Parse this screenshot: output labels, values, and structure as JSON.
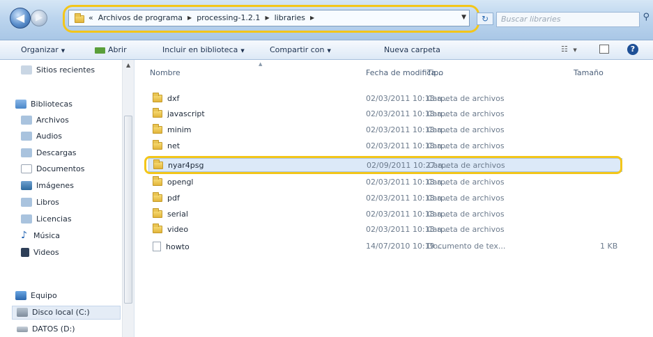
{
  "address": {
    "back_glyph": "◀",
    "forward_glyph": "▶",
    "overflow": "«",
    "crumbs": [
      "Archivos de programa",
      "processing-1.2.1",
      "libraries"
    ],
    "search_placeholder": "Buscar libraries",
    "highlight_color": "#f3c61a"
  },
  "toolbar": {
    "organize": "Organizar",
    "open": "Abrir",
    "include": "Incluir en biblioteca",
    "share": "Compartir con",
    "new_folder": "Nueva carpeta",
    "help": "?"
  },
  "sidebar": {
    "recent": "Sitios recientes",
    "libraries": "Bibliotecas",
    "lib_items": [
      "Archivos",
      "Audios",
      "Descargas",
      "Documentos",
      "Imágenes",
      "Libros",
      "Licencias",
      "Música",
      "Videos"
    ],
    "computer": "Equipo",
    "drives": [
      "Disco local (C:)",
      "DATOS (D:)"
    ]
  },
  "columns": {
    "name": "Nombre",
    "date": "Fecha de modifica...",
    "type": "Tipo",
    "size": "Tamaño"
  },
  "files": [
    {
      "name": "dxf",
      "date": "02/03/2011 10:18 a...",
      "type": "Carpeta de archivos",
      "size": ""
    },
    {
      "name": "javascript",
      "date": "02/03/2011 10:18 a...",
      "type": "Carpeta de archivos",
      "size": ""
    },
    {
      "name": "minim",
      "date": "02/03/2011 10:18 a...",
      "type": "Carpeta de archivos",
      "size": ""
    },
    {
      "name": "net",
      "date": "02/03/2011 10:18 a...",
      "type": "Carpeta de archivos",
      "size": ""
    },
    {
      "name": "nyar4psg",
      "date": "02/09/2011 10:27 a...",
      "type": "Carpeta de archivos",
      "size": ""
    },
    {
      "name": "opengl",
      "date": "02/03/2011 10:18 a...",
      "type": "Carpeta de archivos",
      "size": ""
    },
    {
      "name": "pdf",
      "date": "02/03/2011 10:18 a...",
      "type": "Carpeta de archivos",
      "size": ""
    },
    {
      "name": "serial",
      "date": "02/03/2011 10:18 a...",
      "type": "Carpeta de archivos",
      "size": ""
    },
    {
      "name": "video",
      "date": "02/03/2011 10:18 a...",
      "type": "Carpeta de archivos",
      "size": ""
    },
    {
      "name": "howto",
      "date": "14/07/2010 10:19 ...",
      "type": "Documento de tex...",
      "size": "1 KB"
    }
  ]
}
